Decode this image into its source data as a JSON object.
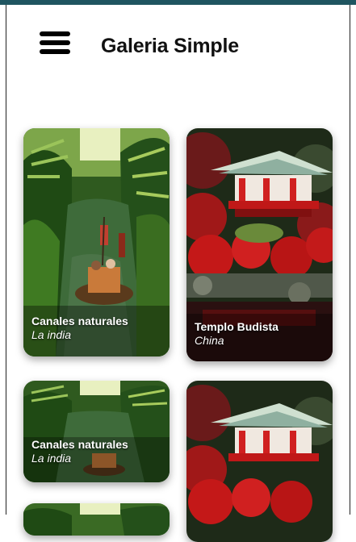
{
  "header": {
    "title": "Galeria Simple",
    "menu_icon": "hamburger-menu-icon"
  },
  "cards": [
    {
      "title": "Canales naturales",
      "subtitle": "La india",
      "image": "canal-boat-jungle-photo"
    },
    {
      "title": "Templo Budista",
      "subtitle": "China",
      "image": "red-pagoda-temple-photo"
    },
    {
      "title": "Canales naturales",
      "subtitle": "La india",
      "image": "canal-boat-jungle-photo"
    },
    {
      "title": "",
      "subtitle": "",
      "image": "red-pagoda-temple-photo"
    },
    {
      "title": "",
      "subtitle": "",
      "image": "canal-boat-jungle-photo"
    }
  ],
  "colors": {
    "topbar": "#1f5560",
    "caption": "#ffffff"
  }
}
